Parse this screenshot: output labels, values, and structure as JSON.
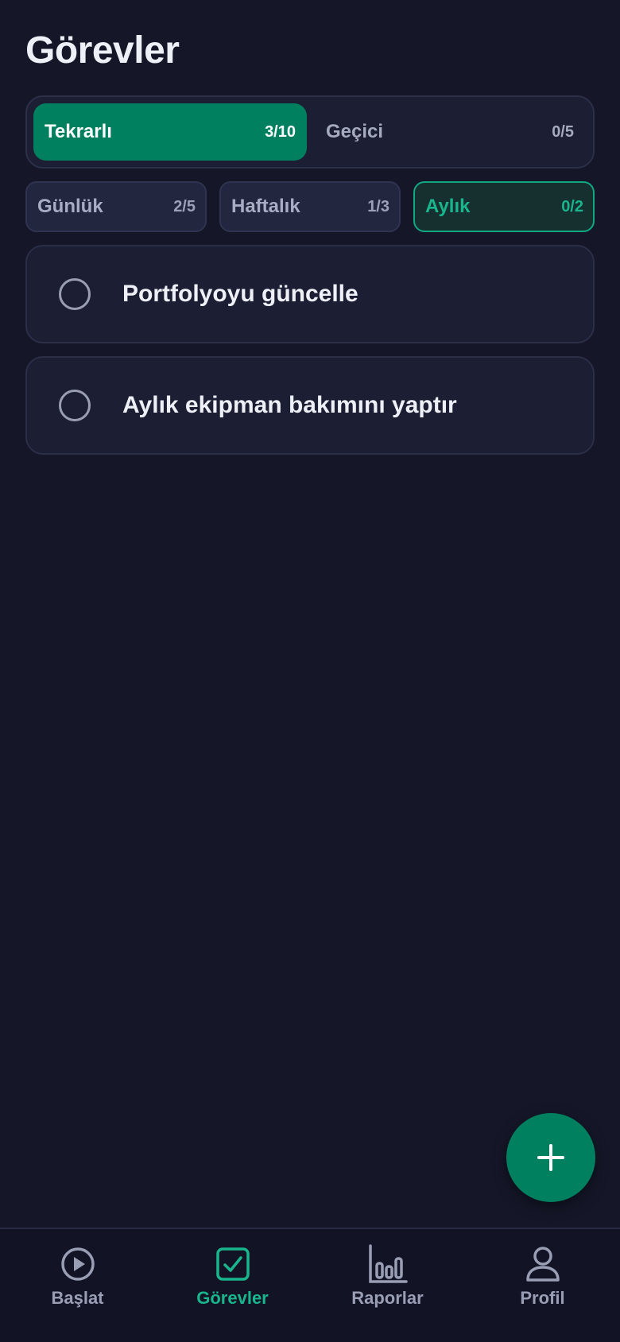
{
  "header": {
    "title": "Görevler"
  },
  "segment": {
    "tabs": [
      {
        "label": "Tekrarlı",
        "count": "3/10"
      },
      {
        "label": "Geçici",
        "count": "0/5"
      }
    ]
  },
  "periods": [
    {
      "label": "Günlük",
      "count": "2/5"
    },
    {
      "label": "Haftalık",
      "count": "1/3"
    },
    {
      "label": "Aylık",
      "count": "0/2"
    }
  ],
  "tasks": [
    {
      "title": "Portfolyoyu güncelle"
    },
    {
      "title": "Aylık ekipman bakımını yaptır"
    }
  ],
  "nav": [
    {
      "label": "Başlat",
      "icon": "play-icon"
    },
    {
      "label": "Görevler",
      "icon": "checkbox-icon"
    },
    {
      "label": "Raporlar",
      "icon": "bar-chart-icon"
    },
    {
      "label": "Profil",
      "icon": "user-icon"
    }
  ],
  "colors": {
    "accent": "#01805f",
    "accent_text": "#19b58c",
    "background": "#151729"
  }
}
